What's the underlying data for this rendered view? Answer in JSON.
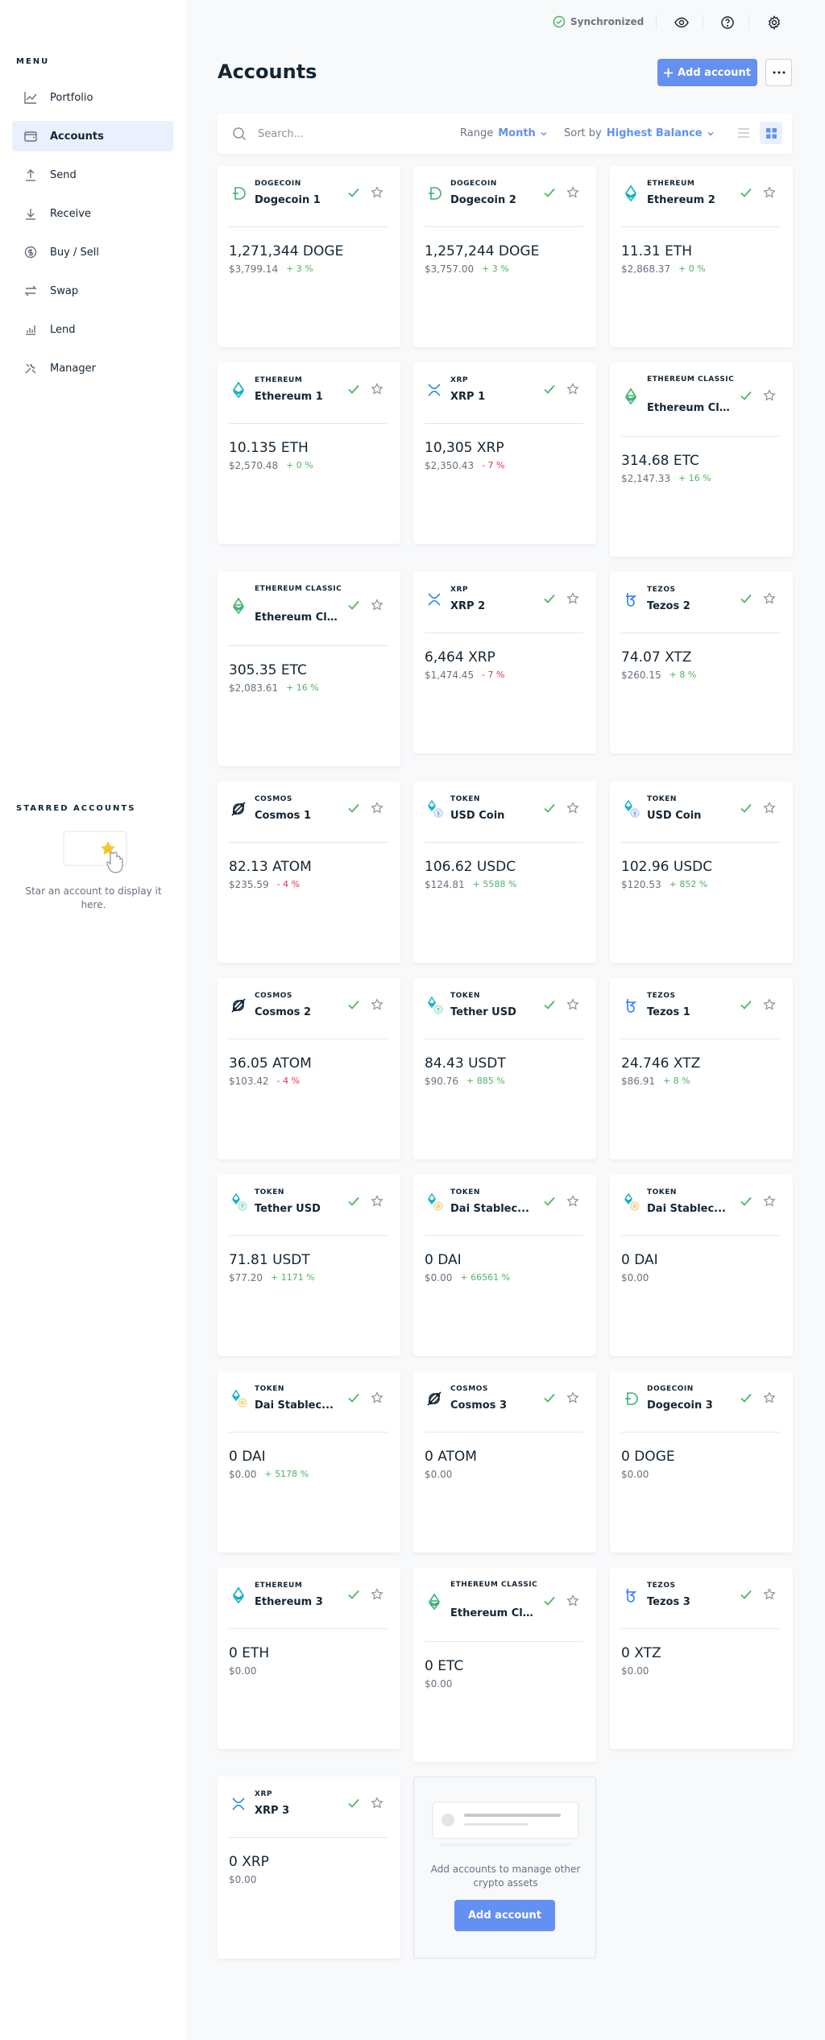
{
  "topbar": {
    "sync_label": "Synchronized"
  },
  "sidebar": {
    "menu_title": "MENU",
    "items": [
      {
        "label": "Portfolio",
        "icon": "chart-icon"
      },
      {
        "label": "Accounts",
        "icon": "wallet-icon",
        "active": true
      },
      {
        "label": "Send",
        "icon": "send-icon"
      },
      {
        "label": "Receive",
        "icon": "receive-icon"
      },
      {
        "label": "Buy / Sell",
        "icon": "exchange-icon"
      },
      {
        "label": "Swap",
        "icon": "swap-icon"
      },
      {
        "label": "Lend",
        "icon": "lend-icon"
      },
      {
        "label": "Manager",
        "icon": "tools-icon"
      }
    ],
    "starred_title": "STARRED ACCOUNTS",
    "starred_empty": "Star an account to display it here."
  },
  "header": {
    "title": "Accounts",
    "add_label": "Add account"
  },
  "toolbar": {
    "search_placeholder": "Search...",
    "range_label": "Range",
    "range_value": "Month",
    "sort_label": "Sort by",
    "sort_value": "Highest Balance"
  },
  "colors": {
    "accent": "#6490f1",
    "positive": "#4cb564",
    "negative": "#ea2e49"
  },
  "cards": [
    {
      "family": "DOGECOIN",
      "name": "Dogecoin 1",
      "balance": "1,271,344 DOGE",
      "fiat": "$3,799.14",
      "change": "+ 3 %",
      "trend": "pos",
      "icon": "dogecoin-icon",
      "color": "#3cb371"
    },
    {
      "family": "DOGECOIN",
      "name": "Dogecoin 2",
      "balance": "1,257,244 DOGE",
      "fiat": "$3,757.00",
      "change": "+ 3 %",
      "trend": "pos",
      "icon": "dogecoin-icon",
      "color": "#3cb371"
    },
    {
      "family": "ETHEREUM",
      "name": "Ethereum 2",
      "balance": "11.31 ETH",
      "fiat": "$2,868.37",
      "change": "+ 0 %",
      "trend": "pos",
      "icon": "ethereum-icon",
      "color": "#0eb1c6"
    },
    {
      "family": "ETHEREUM",
      "name": "Ethereum 1",
      "balance": "10.135 ETH",
      "fiat": "$2,570.48",
      "change": "+ 0 %",
      "trend": "pos",
      "icon": "ethereum-icon",
      "color": "#0eb1c6"
    },
    {
      "family": "XRP",
      "name": "XRP 1",
      "balance": "10,305 XRP",
      "fiat": "$2,350.43",
      "change": "- 7 %",
      "trend": "neg",
      "icon": "xrp-icon",
      "color": "#2a8fd8"
    },
    {
      "family": "ETHEREUM CLASSIC",
      "name": "Ethereum Clas...",
      "balance": "314.68 ETC",
      "fiat": "$2,147.33",
      "change": "+ 16 %",
      "trend": "pos",
      "icon": "ethereum-classic-icon",
      "color": "#3cb371"
    },
    {
      "family": "ETHEREUM CLASSIC",
      "name": "Ethereum Clas...",
      "balance": "305.35 ETC",
      "fiat": "$2,083.61",
      "change": "+ 16 %",
      "trend": "pos",
      "icon": "ethereum-classic-icon",
      "color": "#3cb371"
    },
    {
      "family": "XRP",
      "name": "XRP 2",
      "balance": "6,464 XRP",
      "fiat": "$1,474.45",
      "change": "- 7 %",
      "trend": "neg",
      "icon": "xrp-icon",
      "color": "#2a8fd8"
    },
    {
      "family": "TEZOS",
      "name": "Tezos 2",
      "balance": "74.07 XTZ",
      "fiat": "$260.15",
      "change": "+ 8 %",
      "trend": "pos",
      "icon": "tezos-icon",
      "color": "#2c7df7"
    },
    {
      "family": "COSMOS",
      "name": "Cosmos 1",
      "balance": "82.13 ATOM",
      "fiat": "$235.59",
      "change": "- 4 %",
      "trend": "neg",
      "icon": "cosmos-icon",
      "color": "#142533"
    },
    {
      "family": "TOKEN",
      "name": "USD Coin",
      "balance": "106.62 USDC",
      "fiat": "$124.81",
      "change": "+ 5588 %",
      "trend": "pos",
      "icon": "usdc-token-icon",
      "color": "#0eb1c6"
    },
    {
      "family": "TOKEN",
      "name": "USD Coin",
      "balance": "102.96 USDC",
      "fiat": "$120.53",
      "change": "+ 852 %",
      "trend": "pos",
      "icon": "usdc-token-icon",
      "color": "#0eb1c6"
    },
    {
      "family": "COSMOS",
      "name": "Cosmos 2",
      "balance": "36.05 ATOM",
      "fiat": "$103.42",
      "change": "- 4 %",
      "trend": "neg",
      "icon": "cosmos-icon",
      "color": "#142533"
    },
    {
      "family": "TOKEN",
      "name": "Tether USD",
      "balance": "84.43 USDT",
      "fiat": "$90.76",
      "change": "+ 885 %",
      "trend": "pos",
      "icon": "tether-token-icon",
      "color": "#0eb1c6"
    },
    {
      "family": "TEZOS",
      "name": "Tezos 1",
      "balance": "24.746 XTZ",
      "fiat": "$86.91",
      "change": "+ 8 %",
      "trend": "pos",
      "icon": "tezos-icon",
      "color": "#2c7df7"
    },
    {
      "family": "TOKEN",
      "name": "Tether USD",
      "balance": "71.81 USDT",
      "fiat": "$77.20",
      "change": "+ 1171 %",
      "trend": "pos",
      "icon": "tether-token-icon",
      "color": "#0eb1c6"
    },
    {
      "family": "TOKEN",
      "name": "Dai Stablec...",
      "balance": "0 DAI",
      "fiat": "$0.00",
      "change": "+ 66561 %",
      "trend": "pos",
      "icon": "dai-token-icon",
      "color": "#0eb1c6"
    },
    {
      "family": "TOKEN",
      "name": "Dai Stablec...",
      "balance": "0 DAI",
      "fiat": "$0.00",
      "change": "",
      "trend": "pos",
      "icon": "dai-token-icon",
      "color": "#0eb1c6"
    },
    {
      "family": "TOKEN",
      "name": "Dai Stablec...",
      "balance": "0 DAI",
      "fiat": "$0.00",
      "change": "+ 5178 %",
      "trend": "pos",
      "icon": "dai-token-icon",
      "color": "#0eb1c6"
    },
    {
      "family": "COSMOS",
      "name": "Cosmos 3",
      "balance": "0 ATOM",
      "fiat": "$0.00",
      "change": "",
      "trend": "pos",
      "icon": "cosmos-icon",
      "color": "#142533"
    },
    {
      "family": "DOGECOIN",
      "name": "Dogecoin 3",
      "balance": "0 DOGE",
      "fiat": "$0.00",
      "change": "",
      "trend": "pos",
      "icon": "dogecoin-icon",
      "color": "#3cb371"
    },
    {
      "family": "ETHEREUM",
      "name": "Ethereum 3",
      "balance": "0 ETH",
      "fiat": "$0.00",
      "change": "",
      "trend": "pos",
      "icon": "ethereum-icon",
      "color": "#0eb1c6"
    },
    {
      "family": "ETHEREUM CLASSIC",
      "name": "Ethereum Clas...",
      "balance": "0 ETC",
      "fiat": "$0.00",
      "change": "",
      "trend": "pos",
      "icon": "ethereum-classic-icon",
      "color": "#3cb371"
    },
    {
      "family": "TEZOS",
      "name": "Tezos 3",
      "balance": "0 XTZ",
      "fiat": "$0.00",
      "change": "",
      "trend": "pos",
      "icon": "tezos-icon",
      "color": "#2c7df7"
    },
    {
      "family": "XRP",
      "name": "XRP 3",
      "balance": "0 XRP",
      "fiat": "$0.00",
      "change": "",
      "trend": "pos",
      "icon": "xrp-icon",
      "color": "#2a8fd8"
    }
  ],
  "empty_card": {
    "text": "Add accounts to manage other crypto assets",
    "button": "Add account"
  }
}
